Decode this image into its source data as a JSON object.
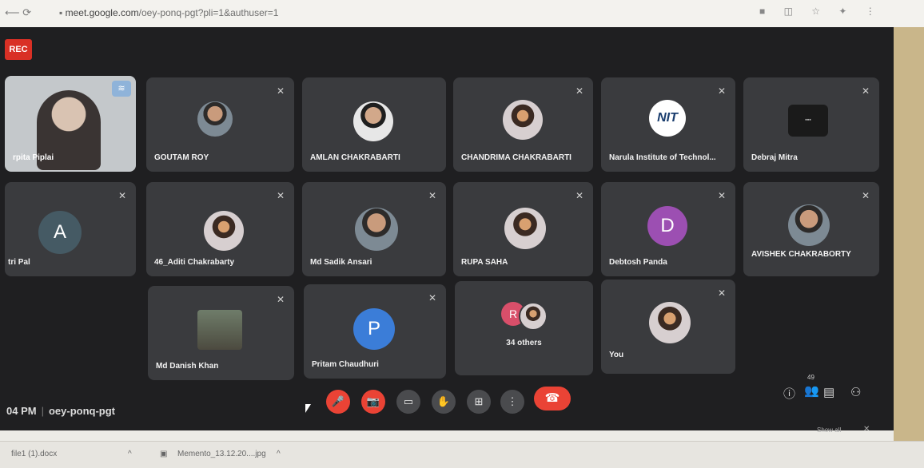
{
  "browser": {
    "nav_glyphs": "⟵ ⟳",
    "url_host": "meet.google.com",
    "url_path": "/oey-ponq-pgt?pli=1&authuser=1",
    "action_glyphs": "■ ◫ ☆ ✦ ⋮"
  },
  "recording_badge": "REC",
  "tiles": [
    {
      "name": "rpita Piplai",
      "type": "video"
    },
    {
      "name": "GOUTAM ROY",
      "type": "photo"
    },
    {
      "name": "AMLAN CHAKRABARTI",
      "type": "photo"
    },
    {
      "name": "CHANDRIMA CHAKRABARTI",
      "type": "photo"
    },
    {
      "name": "Narula Institute of Technol...",
      "type": "logo",
      "logo_text": "NIT"
    },
    {
      "name": "Debraj Mitra",
      "type": "photo"
    },
    {
      "name": "tri Pal",
      "type": "letter",
      "letter": "A",
      "color": "#455a64"
    },
    {
      "name": "46_Aditi Chakrabarty",
      "type": "photo"
    },
    {
      "name": "Md Sadik Ansari",
      "type": "photo"
    },
    {
      "name": "RUPA SAHA",
      "type": "photo"
    },
    {
      "name": "Debtosh Panda",
      "type": "letter",
      "letter": "D",
      "color": "#9c4fb2"
    },
    {
      "name": "AVISHEK CHAKRABORTY",
      "type": "photo"
    },
    {
      "name": "Md Danish Khan",
      "type": "photo"
    },
    {
      "name": "Pritam Chaudhuri",
      "type": "letter",
      "letter": "P",
      "color": "#3b7dd8"
    },
    {
      "name": "34 others",
      "type": "group",
      "letter": "R"
    },
    {
      "name": "You",
      "type": "photo"
    }
  ],
  "meeting": {
    "time": "04 PM",
    "code": "oey-ponq-pgt"
  },
  "controls": {
    "mic": "🎤",
    "cam": "📷",
    "captions": "▭",
    "hand": "✋",
    "present": "⊞",
    "more": "⋮",
    "hangup": "☎"
  },
  "right_icons": {
    "info": "ⓘ",
    "people": "👥",
    "participant_count": "49",
    "chat": "▤",
    "activities": "⚇"
  },
  "downloads": [
    {
      "label": "file1 (1).docx"
    },
    {
      "label": "Memento_13.12.20....jpg"
    }
  ],
  "show_all": "Show all",
  "colors": {
    "accent_red": "#ea4335",
    "tile_bg": "#3a3b3e",
    "meet_bg": "#1f1f21"
  }
}
